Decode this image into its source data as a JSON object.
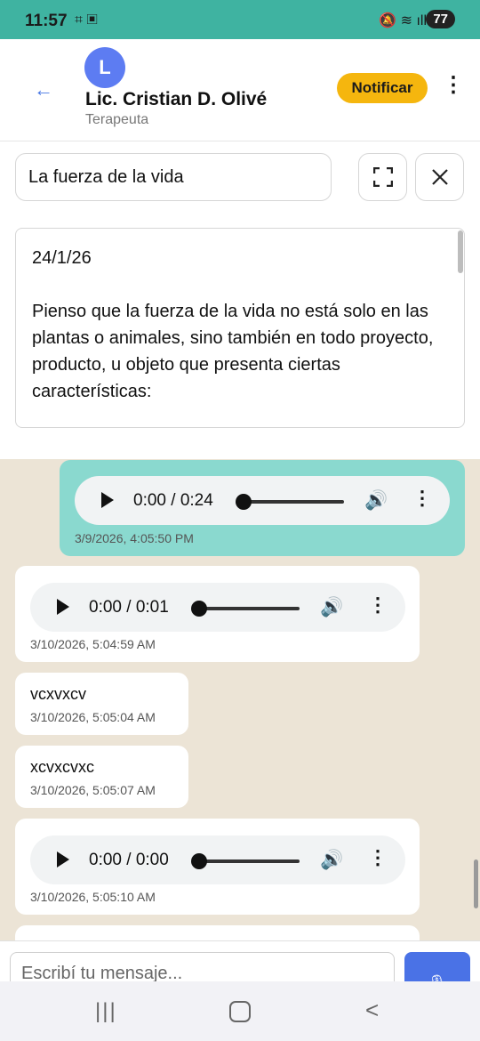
{
  "status_bar": {
    "time": "11:57",
    "battery": "77"
  },
  "header": {
    "back_icon": "←",
    "avatar_initial": "L",
    "contact_name": "Lic. Cristian D. Olivé",
    "contact_role": "Terapeuta",
    "notify_label": "Notificar"
  },
  "note": {
    "title": "La fuerza de la vida",
    "date": "24/1/26",
    "body": "Pienso que la fuerza de la vida no está solo en las plantas o animales, sino también en todo proyecto, producto, u objeto que presenta ciertas características:"
  },
  "messages": [
    {
      "type": "audio",
      "direction": "out",
      "time": "0:00 / 0:24",
      "timestamp": "3/9/2026, 4:05:50 PM"
    },
    {
      "type": "audio",
      "direction": "in",
      "time": "0:00 / 0:01",
      "timestamp": "3/10/2026, 5:04:59 AM"
    },
    {
      "type": "text",
      "direction": "in",
      "text": "vcxvxcv",
      "timestamp": "3/10/2026, 5:05:04 AM"
    },
    {
      "type": "text",
      "direction": "in",
      "text": "xcvxcvxc",
      "timestamp": "3/10/2026, 5:05:07 AM"
    },
    {
      "type": "audio",
      "direction": "in",
      "time": "0:00 / 0:00",
      "timestamp": "3/10/2026, 5:05:10 AM"
    }
  ],
  "composer": {
    "placeholder": "Escribí tu mensaje..."
  },
  "icons": {
    "back": "arrow-left-icon",
    "more": "more-vertical-icon",
    "expand": "fullscreen-icon",
    "close": "close-icon",
    "play": "play-icon",
    "volume": "volume-icon",
    "send": "mic-icon"
  },
  "colors": {
    "status_bar": "#3fb3a1",
    "notify": "#f5b60e",
    "avatar": "#5d7cf2",
    "outgoing_bubble": "#8ad9cf",
    "chat_background": "#ece4d6",
    "send_button": "#4a72e6"
  }
}
